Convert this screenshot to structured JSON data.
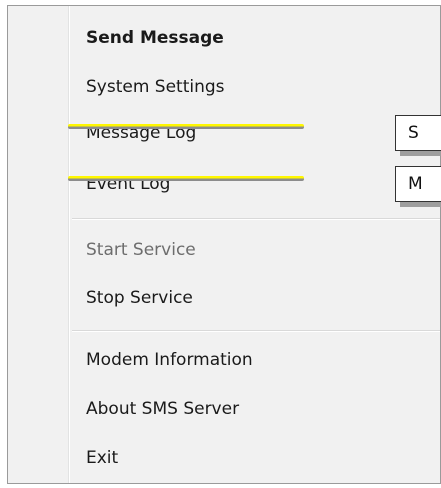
{
  "menu": {
    "items": [
      {
        "label": "Send Message"
      },
      {
        "label": "System Settings"
      },
      {
        "label": "Message Log"
      },
      {
        "label": "Event Log"
      },
      {
        "label": "Start Service"
      },
      {
        "label": "Stop Service"
      },
      {
        "label": "Modem Information"
      },
      {
        "label": "About SMS Server"
      },
      {
        "label": "Exit"
      }
    ]
  },
  "callouts": [
    {
      "text": "S"
    },
    {
      "text": "M"
    }
  ],
  "colors": {
    "highlight": "#fff700",
    "menu_background": "#f1f1f1",
    "disabled_text": "#6d6d6d"
  }
}
